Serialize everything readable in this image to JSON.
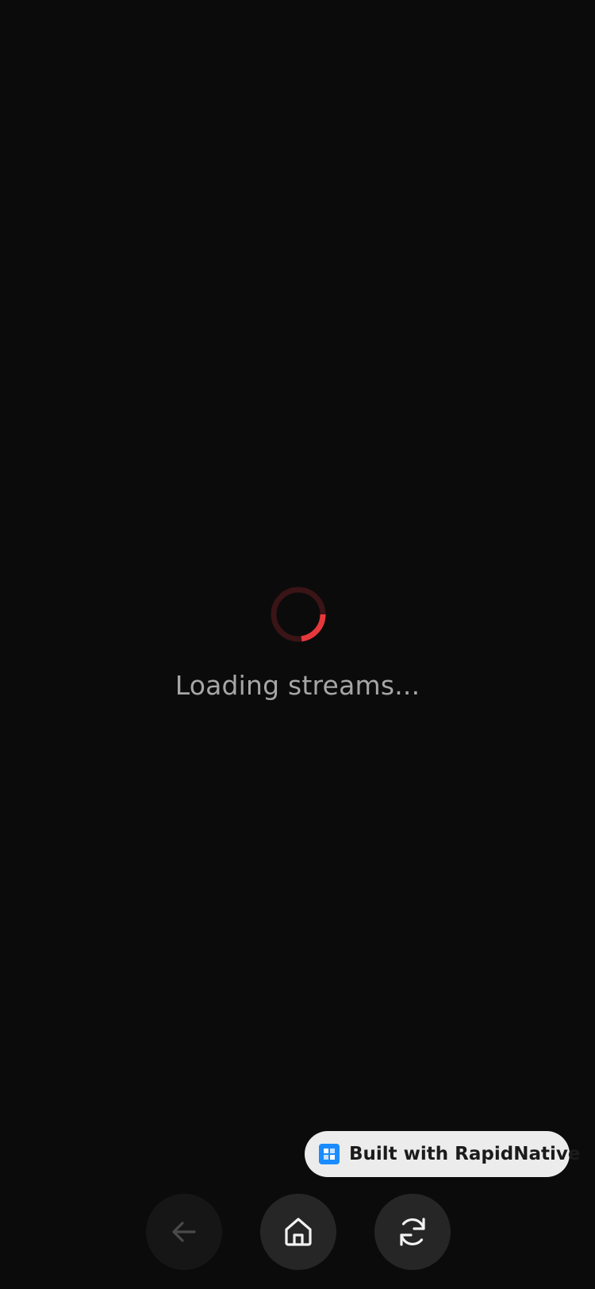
{
  "loading": {
    "message": "Loading streams...",
    "spinner_track_color": "#3a1416",
    "spinner_arc_color": "#e5383b"
  },
  "badge": {
    "label": "Built with RapidNative",
    "logo_color": "#1a8cff",
    "icon": "rapidnative-logo-icon"
  },
  "nav": {
    "back": {
      "icon": "arrow-left-icon",
      "enabled": false
    },
    "home": {
      "icon": "home-icon",
      "enabled": true
    },
    "refresh": {
      "icon": "refresh-icon",
      "enabled": true
    }
  }
}
